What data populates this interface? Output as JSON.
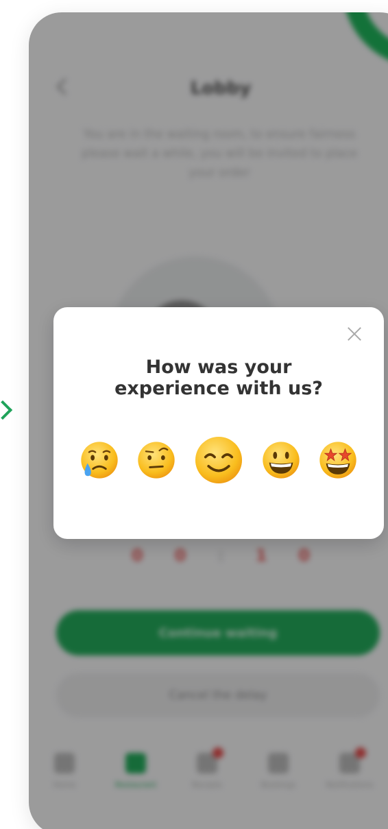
{
  "lobby": {
    "title": "Lobby",
    "description": "You are in the waiting room, to ensure fairness please wait a while, you will be invited to place your order",
    "digits": [
      "0",
      "0",
      ":",
      "1",
      "0"
    ],
    "continue_label": "Continue waiting",
    "cancel_label": "Cancel the delay"
  },
  "nav": {
    "items": [
      {
        "label": "Home",
        "icon": "home-icon",
        "active": false,
        "badge": false
      },
      {
        "label": "Restaurant",
        "icon": "restaurant-icon",
        "active": true,
        "badge": false
      },
      {
        "label": "Recepts",
        "icon": "receipt-icon",
        "active": false,
        "badge": true
      },
      {
        "label": "Bookings",
        "icon": "calendar-icon",
        "active": false,
        "badge": false
      },
      {
        "label": "Notifications",
        "icon": "bell-icon",
        "active": false,
        "badge": true
      }
    ]
  },
  "modal": {
    "title_line1": "How was your",
    "title_line2": "experience with us?",
    "close_icon": "close-icon",
    "ratings": [
      {
        "name": "crying-face",
        "level": 1,
        "selected": false
      },
      {
        "name": "raised-eyebrow-face",
        "level": 2,
        "selected": false
      },
      {
        "name": "smiling-face",
        "level": 3,
        "selected": true
      },
      {
        "name": "grinning-face",
        "level": 4,
        "selected": false
      },
      {
        "name": "star-struck-face",
        "level": 5,
        "selected": false
      }
    ]
  },
  "colors": {
    "accent": "#23a85a",
    "ring": "#1fb25a",
    "timer": "#e35a5a",
    "emoji_yellow": "#f7b718",
    "overlay": "#00000059"
  }
}
